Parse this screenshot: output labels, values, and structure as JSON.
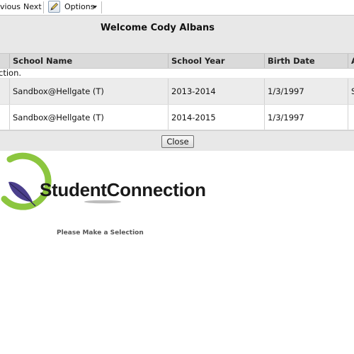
{
  "toolbar": {
    "previous_label": "vious",
    "next_label": "Next",
    "options_label": "Options"
  },
  "dialog": {
    "title": "Welcome Cody Albans",
    "columns": [
      "School Name",
      "School Year",
      "Birth Date",
      "A"
    ],
    "selection_text": "ction.",
    "rows": [
      {
        "school_name": "Sandbox@Hellgate (T)",
        "school_year": "2013-2014",
        "birth_date": "1/3/1997",
        "extra": "S"
      },
      {
        "school_name": "Sandbox@Hellgate (T)",
        "school_year": "2014-2015",
        "birth_date": "1/3/1997",
        "extra": ""
      }
    ],
    "close_label": "Close"
  },
  "logo": {
    "text": "StudentConnection",
    "colors": {
      "ring": "#8cc63f",
      "leaf": "#4b3f8c"
    }
  },
  "main": {
    "prompt": "Please Make a Selection"
  }
}
